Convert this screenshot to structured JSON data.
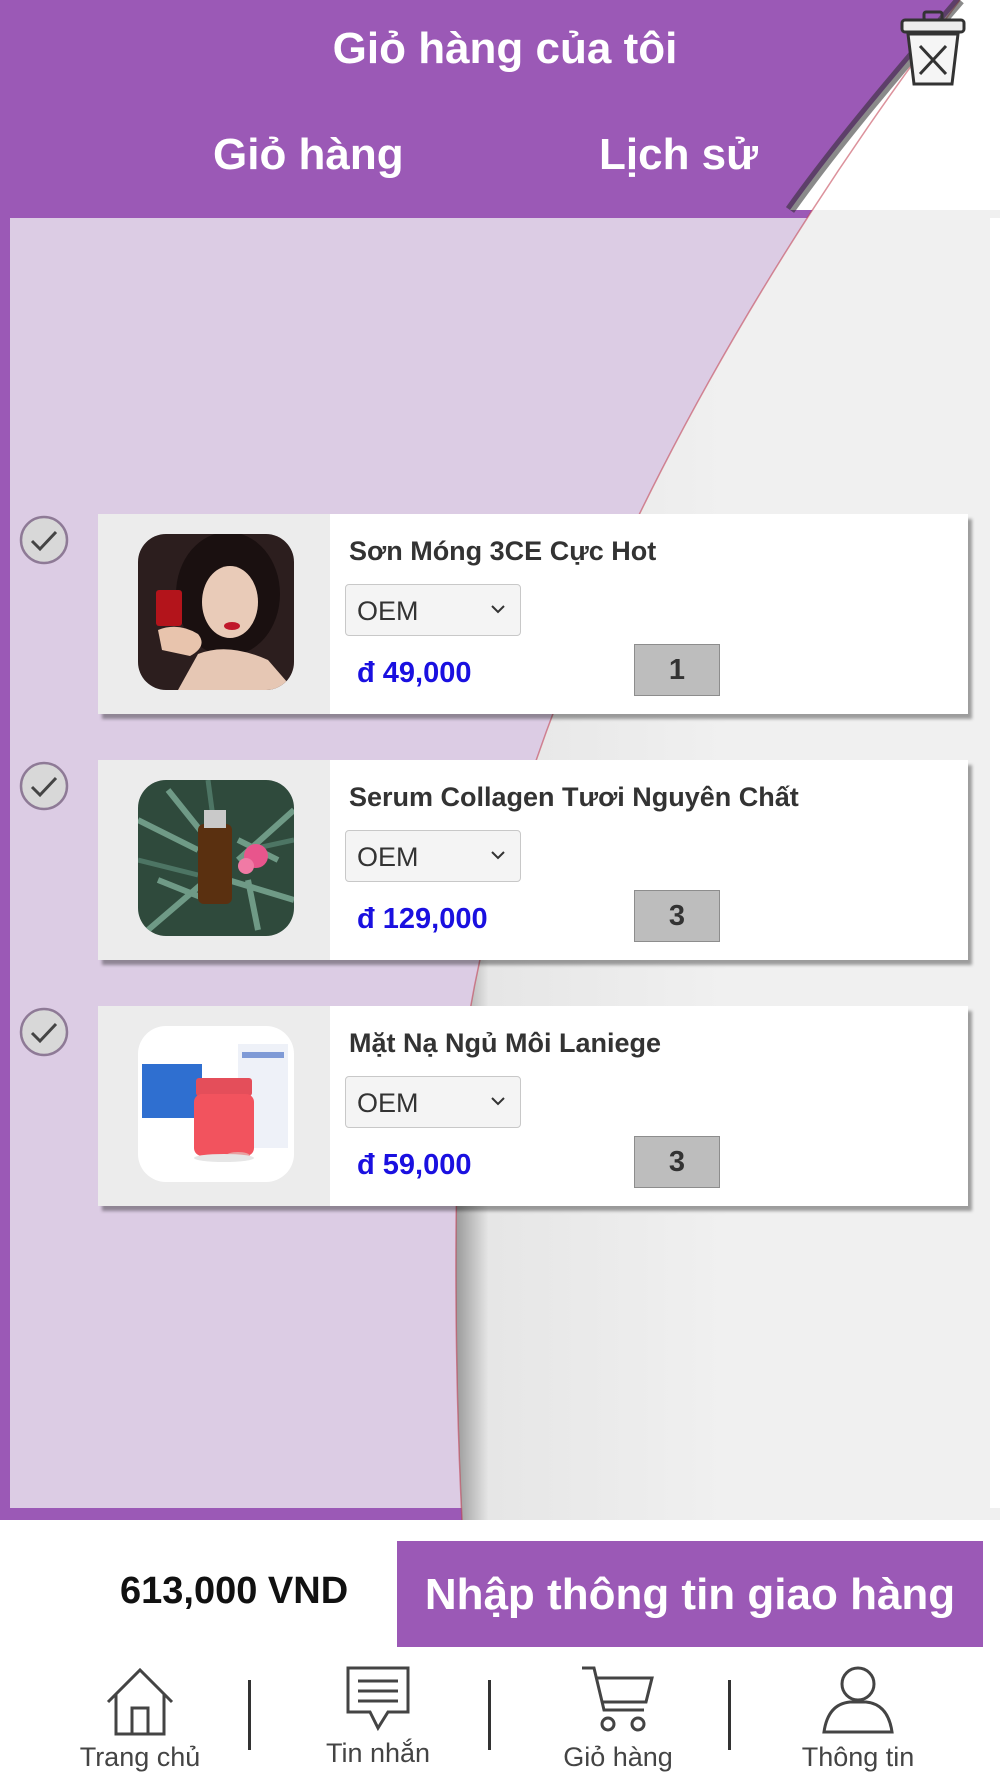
{
  "header": {
    "title": "Giỏ hàng của tôi"
  },
  "tabs": [
    {
      "label": "Giỏ hàng"
    },
    {
      "label": "Lịch sử"
    }
  ],
  "cart": {
    "items": [
      {
        "name": "Sơn Móng 3CE Cực Hot",
        "variant": "OEM",
        "price": "đ 49,000",
        "quantity": "1",
        "checked": true
      },
      {
        "name": "Serum Collagen Tươi Nguyên Chất",
        "variant": "OEM",
        "price": "đ 129,000",
        "quantity": "3",
        "checked": true
      },
      {
        "name": "Mặt Nạ Ngủ Môi Laniege",
        "variant": "OEM",
        "price": "đ 59,000",
        "quantity": "3",
        "checked": true
      }
    ]
  },
  "footer": {
    "total": "613,000 VND",
    "checkout_label": "Nhập thông tin giao hàng"
  },
  "nav": [
    {
      "label": "Trang chủ",
      "icon": "home-icon"
    },
    {
      "label": "Tin nhắn",
      "icon": "message-icon"
    },
    {
      "label": "Giỏ hàng",
      "icon": "cart-icon"
    },
    {
      "label": "Thông tin",
      "icon": "user-icon"
    }
  ],
  "colors": {
    "accent": "#9b59b6",
    "price": "#1a10e0",
    "panel": "#dcccE4"
  }
}
